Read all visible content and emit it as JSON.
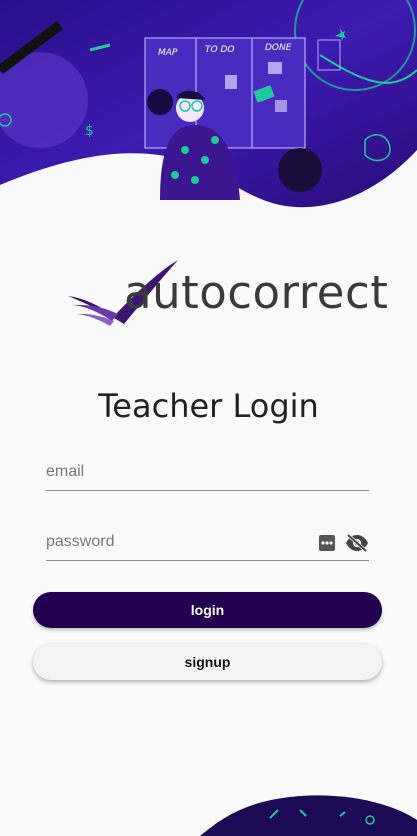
{
  "header": {
    "illustration_icon": "teacher-classroom-illustration",
    "whiteboard_words": [
      "MAP",
      "TO DO",
      "DONE"
    ]
  },
  "brand": {
    "name": "autocorrect",
    "logo_icon": "check-swoosh-logo",
    "colors": {
      "primary": "#23004f",
      "logo_purple": "#5b2a86"
    }
  },
  "page": {
    "title": "Teacher Login"
  },
  "form": {
    "email": {
      "placeholder": "email",
      "value": ""
    },
    "password": {
      "placeholder": "password",
      "value": "",
      "icons": [
        "password-manager-icon",
        "visibility-off-icon"
      ]
    }
  },
  "buttons": {
    "login": "login",
    "signup": "signup"
  }
}
